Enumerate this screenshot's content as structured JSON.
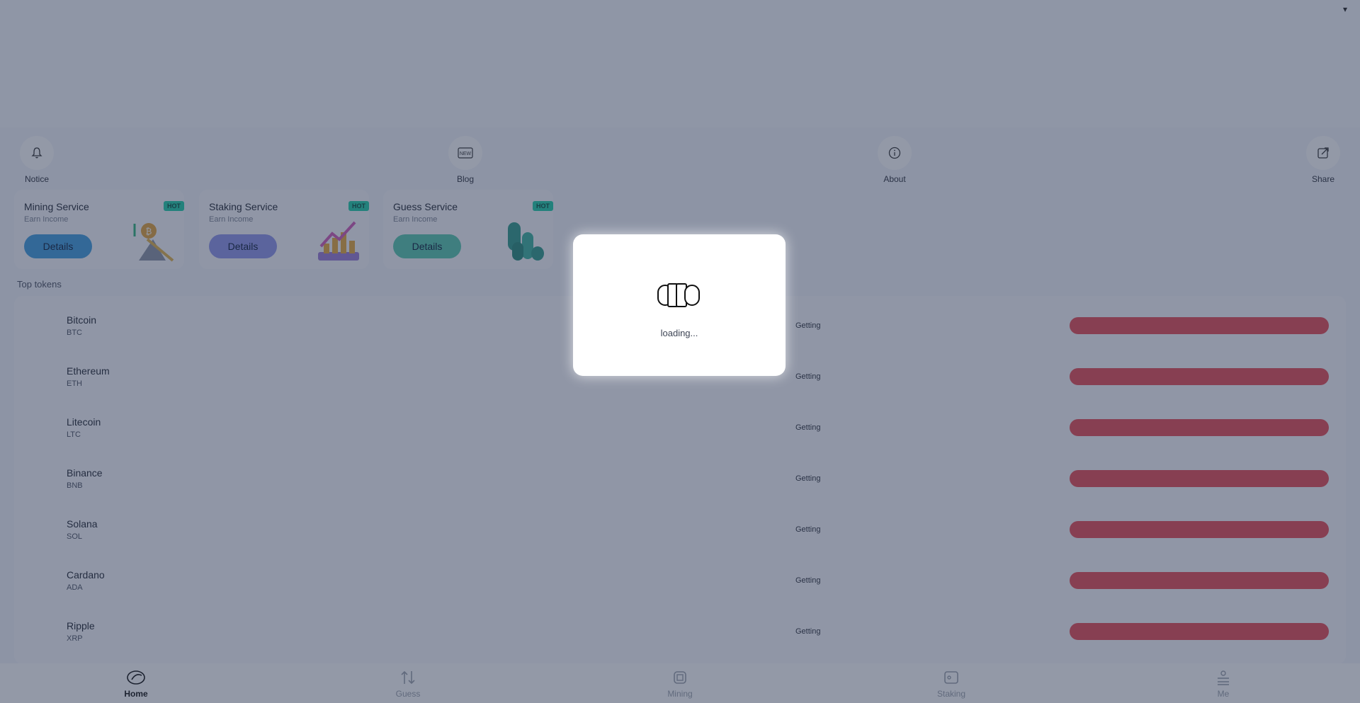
{
  "topbar": {
    "dropdown_icon": "caret-down-icon"
  },
  "quick_actions": [
    {
      "label": "Notice",
      "icon": "bell-icon"
    },
    {
      "label": "Blog",
      "icon": "news-icon",
      "icon_text": "NEW"
    },
    {
      "label": "About",
      "icon": "info-icon"
    },
    {
      "label": "Share",
      "icon": "share-icon"
    }
  ],
  "services": [
    {
      "title": "Mining Service",
      "subtitle": "Earn Income",
      "badge": "HOT",
      "button": "Details",
      "button_color": "#3f9dde",
      "icon": "pickaxe-icon"
    },
    {
      "title": "Staking Service",
      "subtitle": "Earn Income",
      "badge": "HOT",
      "button": "Details",
      "button_color": "#8f95ea",
      "icon": "growth-chart-icon"
    },
    {
      "title": "Guess Service",
      "subtitle": "Earn Income",
      "badge": "HOT",
      "button": "Details",
      "button_color": "#56c8ae",
      "icon": "coins-icon"
    }
  ],
  "top_tokens": {
    "label": "Top tokens",
    "items": [
      {
        "name": "Bitcoin",
        "symbol": "BTC",
        "status": "Getting"
      },
      {
        "name": "Ethereum",
        "symbol": "ETH",
        "status": "Getting"
      },
      {
        "name": "Litecoin",
        "symbol": "LTC",
        "status": "Getting"
      },
      {
        "name": "Binance",
        "symbol": "BNB",
        "status": "Getting"
      },
      {
        "name": "Solana",
        "symbol": "SOL",
        "status": "Getting"
      },
      {
        "name": "Cardano",
        "symbol": "ADA",
        "status": "Getting"
      },
      {
        "name": "Ripple",
        "symbol": "XRP",
        "status": "Getting"
      }
    ],
    "bar_color": "#e64a55"
  },
  "bottom_nav": [
    {
      "label": "Home",
      "icon": "home-icon",
      "active": true
    },
    {
      "label": "Guess",
      "icon": "guess-icon",
      "active": false
    },
    {
      "label": "Mining",
      "icon": "chip-icon",
      "active": false
    },
    {
      "label": "Staking",
      "icon": "wallet-icon",
      "active": false
    },
    {
      "label": "Me",
      "icon": "user-icon",
      "active": false
    }
  ],
  "loading": {
    "text": "loading...",
    "icon": "spinner-icon"
  }
}
